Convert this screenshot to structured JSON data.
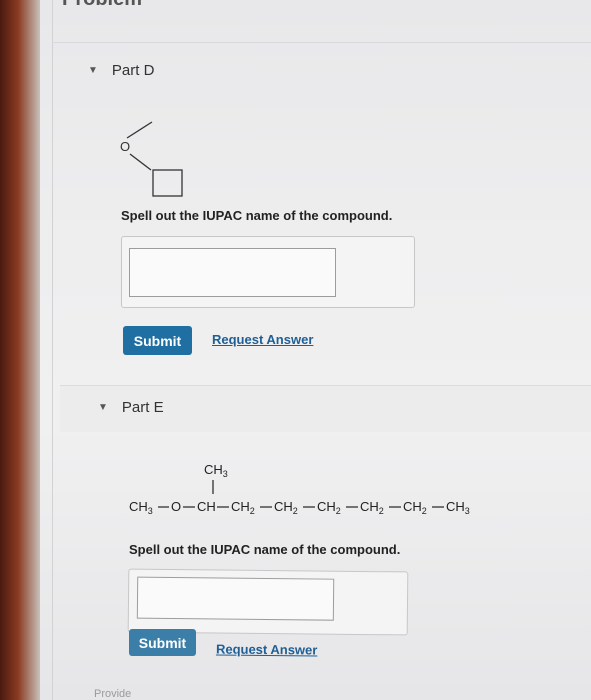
{
  "header": {
    "title_partial": "Problem"
  },
  "parts": [
    {
      "label": "Part D",
      "structure": {
        "atom": "O"
      },
      "prompt": "Spell out the IUPAC name of the compound.",
      "answer": {
        "value": "",
        "placeholder": ""
      },
      "submit_label": "Submit",
      "request_answer_label": "Request Answer"
    },
    {
      "label": "Part E",
      "structure": {
        "branch": "CH3",
        "chain": [
          "CH3",
          "O",
          "CH",
          "CH2",
          "CH2",
          "CH2",
          "CH2",
          "CH2",
          "CH3"
        ]
      },
      "prompt": "Spell out the IUPAC name of the compound.",
      "answer": {
        "value": "",
        "placeholder": ""
      },
      "submit_label": "Submit",
      "request_answer_label": "Request Answer"
    }
  ],
  "footer": {
    "partial_text": "Provide"
  },
  "colors": {
    "submit_bg": "#1f6fa3",
    "link": "#1f5f95",
    "text": "#222222"
  },
  "icons": {
    "collapse": "caret-down-icon"
  }
}
